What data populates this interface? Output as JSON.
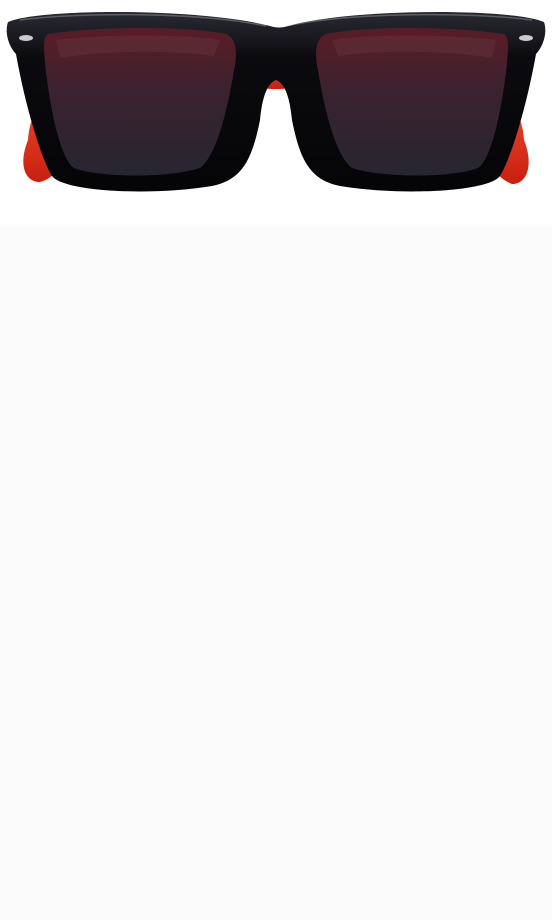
{
  "product": {
    "image_subject": "sunglasses-icon",
    "frame_color": "#0b0b0f",
    "temple_color": "#e8321f",
    "lens_color": "#3a2230"
  },
  "page": {
    "background_top": "#ffffff",
    "background_bottom": "#fcfbfc"
  }
}
